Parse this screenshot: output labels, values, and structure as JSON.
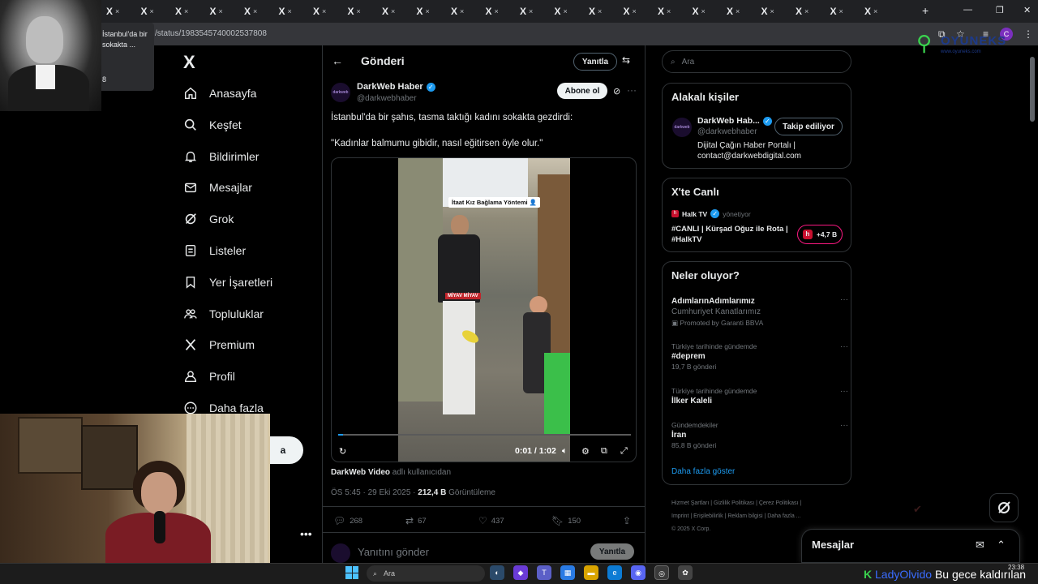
{
  "browser": {
    "tab_glyph": "X",
    "tab_close": "×",
    "tab_count": 23,
    "url": "/status/1983545740002537808",
    "tooltip_lines": [
      "İstanbul'da bir",
      "sokakta ...",
      "8"
    ]
  },
  "nav": {
    "logo": "X",
    "items": [
      {
        "label": "Anasayfa",
        "icon": "home-icon"
      },
      {
        "label": "Keşfet",
        "icon": "search-icon"
      },
      {
        "label": "Bildirimler",
        "icon": "bell-icon"
      },
      {
        "label": "Mesajlar",
        "icon": "mail-icon"
      },
      {
        "label": "Grok",
        "icon": "grok-icon"
      },
      {
        "label": "Listeler",
        "icon": "list-icon"
      },
      {
        "label": "Yer İşaretleri",
        "icon": "bookmark-icon"
      },
      {
        "label": "Topluluklar",
        "icon": "people-icon"
      },
      {
        "label": "Premium",
        "icon": "x-icon"
      },
      {
        "label": "Profil",
        "icon": "person-icon"
      },
      {
        "label": "Daha fazla",
        "icon": "more-icon"
      }
    ],
    "post_label": "a"
  },
  "header": {
    "title": "Gönderi",
    "reply_label": "Yanıtla"
  },
  "post": {
    "avatar_text": "darkweb",
    "author": "DarkWeb Haber",
    "handle": "@darkwebhaber",
    "subscribe_label": "Abone ol",
    "text_line1": "İstanbul'da bir şahıs, tasma taktığı kadını sokakta gezdirdi:",
    "text_line2": "\"Kadınlar balmumu gibidir, nasıl eğitirsen öyle olur.\"",
    "video": {
      "caption": "İtaat Kız Bağlama Yöntemi 👤",
      "tag": "MİYAV MİYAV",
      "time": "0:01 / 1:02",
      "progress": 0.016
    },
    "source_name": "DarkWeb Video",
    "source_suffix": "adlı kullanıcıdan",
    "timestamp": "ÖS 5:45 · 29 Eki 2025 · ",
    "views": "212,4 B",
    "views_label": "Görüntüleme",
    "stats": {
      "replies": "268",
      "reposts": "67",
      "likes": "437",
      "bookmarks": "150"
    },
    "reply_placeholder": "Yanıtını gönder",
    "reply_button": "Yanıtla"
  },
  "sidebar": {
    "search_placeholder": "Ara",
    "related": {
      "title": "Alakalı kişiler",
      "name": "DarkWeb Hab...",
      "handle": "@darkwebhaber",
      "follow_label": "Takip ediliyor",
      "bio": "Dijital Çağın Haber Portalı | contact@darkwebdigital.com"
    },
    "live": {
      "title": "X'te Canlı",
      "source": "Halk TV",
      "source_meta": "yönetiyor",
      "headline": "#CANLI | Kürşad Oğuz ile Rota | #HalkTV",
      "listeners": "+4,7 B"
    },
    "trends": {
      "title": "Neler oluyor?",
      "promo_title": "AdımlarınAdımlarımız",
      "promo_sub": "Cumhuriyet Kanatlarımız",
      "promo_note": "Promoted by Garanti BBVA",
      "items": [
        {
          "context": "Türkiye tarihinde gündemde",
          "title": "#deprem",
          "count": "19,7 B gönderi"
        },
        {
          "context": "Türkiye tarihinde gündemde",
          "title": "İlker Kaleli",
          "count": ""
        },
        {
          "context": "Gündemdekiler",
          "title": "İran",
          "count": "85,8 B gönderi"
        }
      ],
      "show_more": "Daha fazla göster"
    },
    "footer": {
      "line1": "Hizmet Şartları  |  Gizlilik Politikası  |  Çerez Politikası  |",
      "line2": "Imprint  |  Erişilebilirlik  |  Reklam bilgisi  |  Daha fazla ...",
      "line3": "© 2025 X Corp."
    }
  },
  "messages_drawer": {
    "title": "Mesajlar"
  },
  "taskbar": {
    "search": "Ara",
    "time": "23:38",
    "date": "",
    "ticker_logo": "K",
    "ticker_name": "LadyOlvido",
    "ticker_text": "Bu gece kaldırılan"
  },
  "brand_watermark": {
    "name": "OYUNEKS",
    "url": "www.oyuneks.com"
  }
}
